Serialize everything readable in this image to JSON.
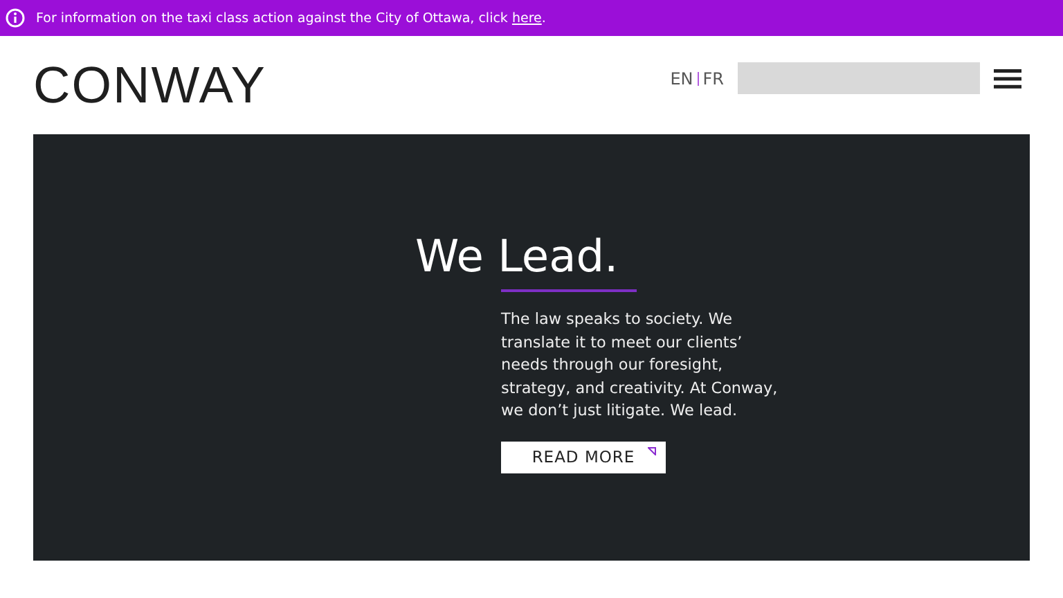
{
  "banner": {
    "text": "For information on the taxi class action against the City of Ottawa, click ",
    "link": "here",
    "end": "."
  },
  "header": {
    "logo": "CONWAY",
    "languages": [
      "EN",
      "FR"
    ]
  },
  "hero": {
    "title": "We Lead.",
    "body": "The law speaks to society. We translate it to meet our clients’ needs through our foresight, strategy, and creativity. At Conway, we don’t just litigate. We lead.",
    "button": "READ MORE"
  }
}
